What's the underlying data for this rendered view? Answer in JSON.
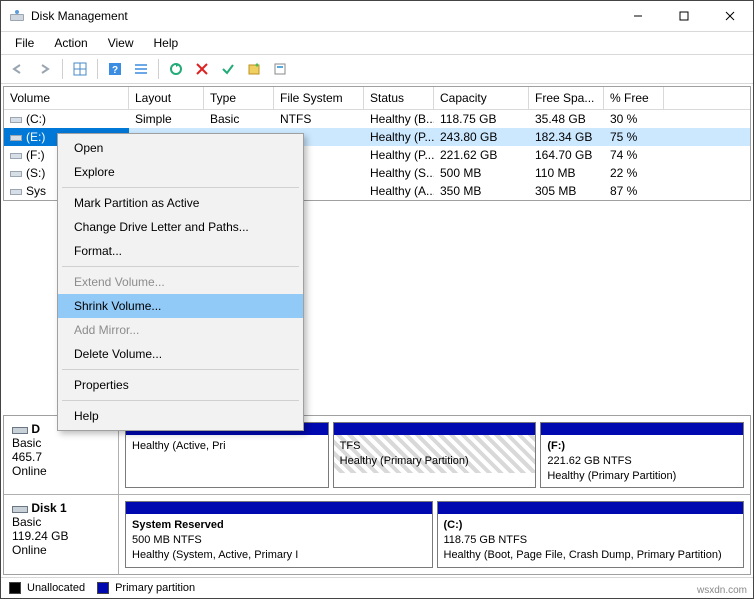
{
  "window": {
    "title": "Disk Management"
  },
  "menu": {
    "file": "File",
    "action": "Action",
    "view": "View",
    "help": "Help"
  },
  "columns": {
    "volume": "Volume",
    "layout": "Layout",
    "type": "Type",
    "filesystem": "File System",
    "status": "Status",
    "capacity": "Capacity",
    "free": "Free Spa...",
    "pfree": "% Free"
  },
  "volumes": [
    {
      "name": "(C:)",
      "layout": "Simple",
      "type": "Basic",
      "fs": "NTFS",
      "status": "Healthy (B...",
      "capacity": "118.75 GB",
      "free": "35.48 GB",
      "pfree": "30 %"
    },
    {
      "name": "(E:)",
      "layout": "",
      "type": "",
      "fs": "",
      "status": "Healthy (P...",
      "capacity": "243.80 GB",
      "free": "182.34 GB",
      "pfree": "75 %"
    },
    {
      "name": "(F:)",
      "layout": "",
      "type": "",
      "fs": "TFS",
      "status": "Healthy (P...",
      "capacity": "221.62 GB",
      "free": "164.70 GB",
      "pfree": "74 %"
    },
    {
      "name": "(S:)",
      "layout": "",
      "type": "",
      "fs": "TFS",
      "status": "Healthy (S...",
      "capacity": "500 MB",
      "free": "110 MB",
      "pfree": "22 %"
    },
    {
      "name": "Sys",
      "layout": "",
      "type": "",
      "fs": "TFS",
      "status": "Healthy (A...",
      "capacity": "350 MB",
      "free": "305 MB",
      "pfree": "87 %"
    }
  ],
  "disks": [
    {
      "name": "D",
      "type": "Basic",
      "size": "465.7",
      "status": "Online",
      "parts": [
        {
          "name": "",
          "size": "",
          "health": "Healthy (Active, Pri"
        },
        {
          "name": "",
          "size": "TFS",
          "health": "Healthy (Primary Partition)",
          "hatched": true
        },
        {
          "name": "(F:)",
          "size": "221.62 GB NTFS",
          "health": "Healthy (Primary Partition)"
        }
      ]
    },
    {
      "name": "Disk 1",
      "type": "Basic",
      "size": "119.24 GB",
      "status": "Online",
      "parts": [
        {
          "name": "System Reserved",
          "size": "500 MB NTFS",
          "health": "Healthy (System, Active, Primary I"
        },
        {
          "name": "(C:)",
          "size": "118.75 GB NTFS",
          "health": "Healthy (Boot, Page File, Crash Dump, Primary Partition)"
        }
      ]
    }
  ],
  "legend": {
    "unalloc": "Unallocated",
    "primary": "Primary partition"
  },
  "context": {
    "open": "Open",
    "explore": "Explore",
    "mark": "Mark Partition as Active",
    "change": "Change Drive Letter and Paths...",
    "format": "Format...",
    "extend": "Extend Volume...",
    "shrink": "Shrink Volume...",
    "mirror": "Add Mirror...",
    "delete": "Delete Volume...",
    "props": "Properties",
    "help": "Help"
  },
  "watermark": "wsxdn.com"
}
